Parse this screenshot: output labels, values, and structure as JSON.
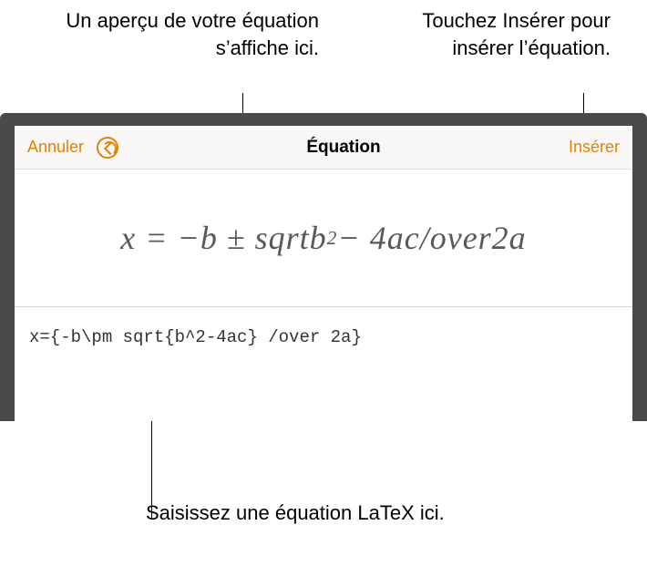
{
  "callouts": {
    "left": "Un aperçu de votre équation s’affiche ici.",
    "right": "Touchez Insérer pour insérer l’équation.",
    "bottom": "Saisissez une équation LaTeX ici."
  },
  "toolbar": {
    "cancel": "Annuler",
    "title": "Équation",
    "insert": "Insérer"
  },
  "equation": {
    "preview_html": "x = −b ± sqrtb<sup>2</sup> − 4ac/over2a",
    "latex": "x={-b\\pm sqrt{b^2-4ac} /over 2a}"
  }
}
